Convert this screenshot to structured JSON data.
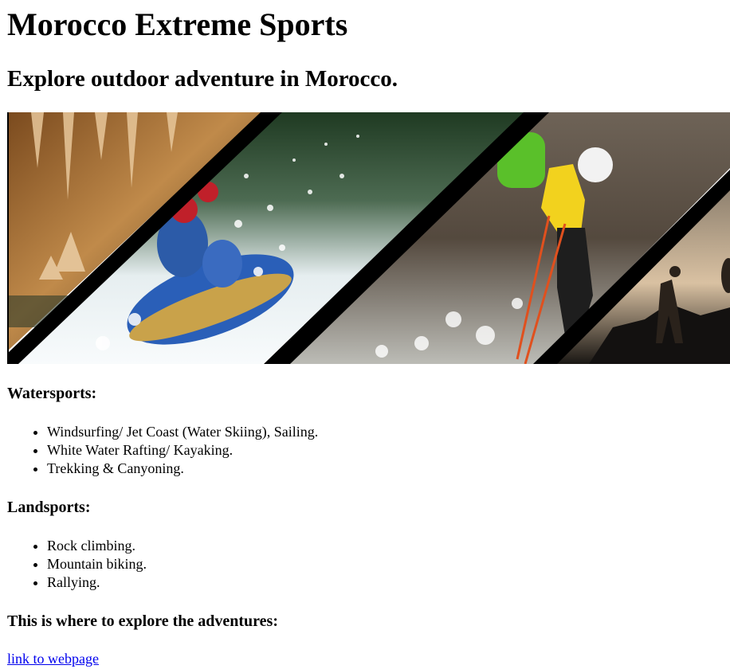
{
  "page": {
    "title": "Morocco Extreme Sports",
    "subtitle": "Explore outdoor adventure in Morocco."
  },
  "hero_image": {
    "icon": "adventure-collage-image",
    "panels": [
      "cave",
      "white-water-rafting",
      "canyoning",
      "hiking"
    ]
  },
  "sections": {
    "watersports": {
      "heading": "Watersports:",
      "items": [
        "Windsurfing/ Jet Coast (Water Skiing), Sailing.",
        "White Water Rafting/ Kayaking.",
        "Trekking & Canyoning."
      ]
    },
    "landsports": {
      "heading": "Landsports:",
      "items": [
        "Rock climbing.",
        "Mountain biking.",
        "Rallying."
      ]
    },
    "explore": {
      "heading": "This is where to explore the adventures:",
      "link_text": "link to webpage"
    }
  },
  "colors": {
    "link": "#0000ee",
    "text": "#000000",
    "background": "#ffffff"
  }
}
